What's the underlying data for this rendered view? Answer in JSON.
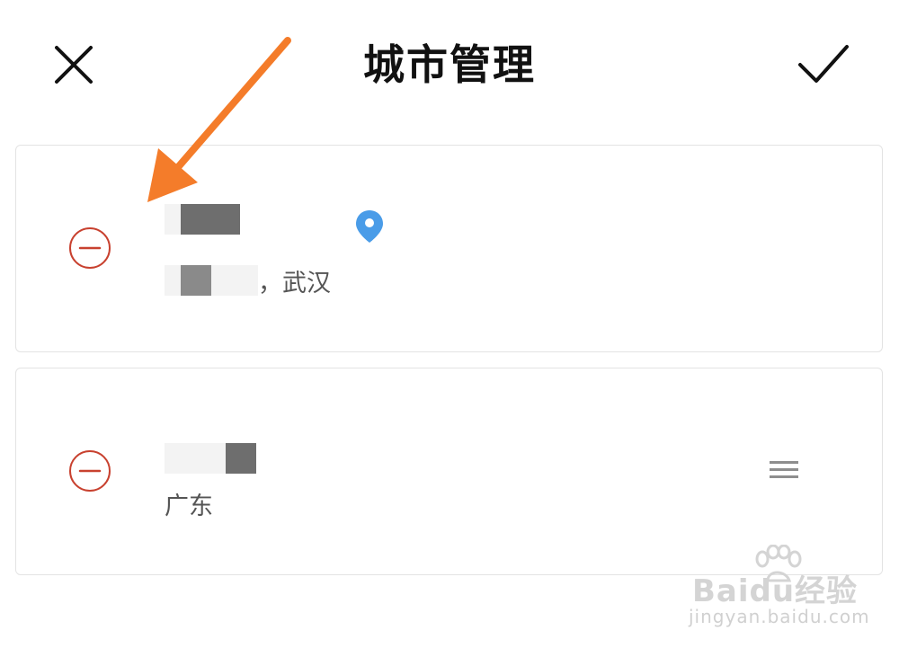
{
  "header": {
    "title": "城市管理",
    "close_icon": "close-icon",
    "confirm_icon": "checkmark-icon"
  },
  "cities": [
    {
      "region": "，武汉",
      "icons": {
        "remove": "minus-circle-icon",
        "location": "location-pin-icon"
      }
    },
    {
      "region": "广东",
      "icons": {
        "remove": "minus-circle-icon",
        "drag": "drag-handle-icon"
      }
    }
  ],
  "watermark": {
    "brand": "Baidu经验",
    "url": "jingyan.baidu.com"
  },
  "colors": {
    "remove_red": "#c8412f",
    "pin_blue": "#4a9ce8",
    "annotation_orange": "#f47c2a",
    "title_text": "#111111",
    "secondary_text": "#555555"
  }
}
